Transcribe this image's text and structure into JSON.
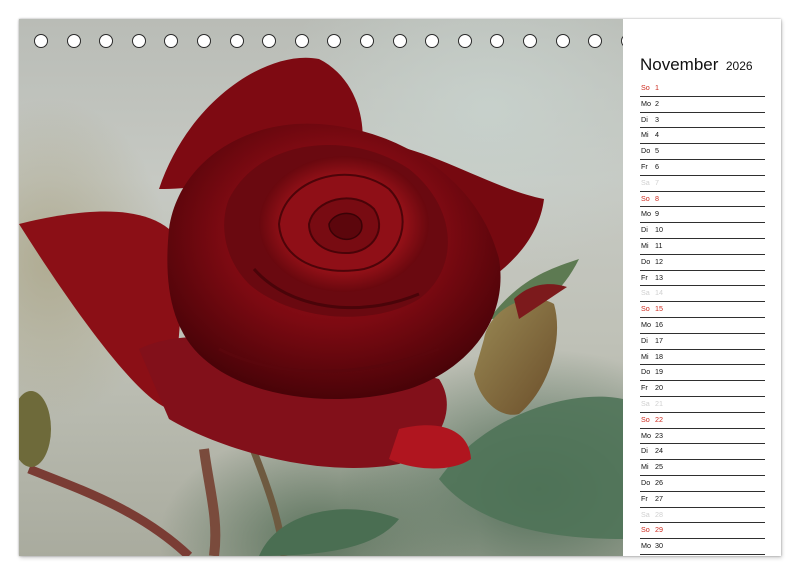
{
  "calendar": {
    "month": "November",
    "year": "2026",
    "days": [
      {
        "name": "So",
        "num": "1",
        "kind": "sunday"
      },
      {
        "name": "Mo",
        "num": "2",
        "kind": "weekday"
      },
      {
        "name": "Di",
        "num": "3",
        "kind": "weekday"
      },
      {
        "name": "Mi",
        "num": "4",
        "kind": "weekday"
      },
      {
        "name": "Do",
        "num": "5",
        "kind": "weekday"
      },
      {
        "name": "Fr",
        "num": "6",
        "kind": "weekday"
      },
      {
        "name": "Sa",
        "num": "7",
        "kind": "saturday"
      },
      {
        "name": "So",
        "num": "8",
        "kind": "sunday"
      },
      {
        "name": "Mo",
        "num": "9",
        "kind": "weekday"
      },
      {
        "name": "Di",
        "num": "10",
        "kind": "weekday"
      },
      {
        "name": "Mi",
        "num": "11",
        "kind": "weekday"
      },
      {
        "name": "Do",
        "num": "12",
        "kind": "weekday"
      },
      {
        "name": "Fr",
        "num": "13",
        "kind": "weekday"
      },
      {
        "name": "Sa",
        "num": "14",
        "kind": "saturday"
      },
      {
        "name": "So",
        "num": "15",
        "kind": "sunday"
      },
      {
        "name": "Mo",
        "num": "16",
        "kind": "weekday"
      },
      {
        "name": "Di",
        "num": "17",
        "kind": "weekday"
      },
      {
        "name": "Mi",
        "num": "18",
        "kind": "weekday"
      },
      {
        "name": "Do",
        "num": "19",
        "kind": "weekday"
      },
      {
        "name": "Fr",
        "num": "20",
        "kind": "weekday"
      },
      {
        "name": "Sa",
        "num": "21",
        "kind": "saturday"
      },
      {
        "name": "So",
        "num": "22",
        "kind": "sunday"
      },
      {
        "name": "Mo",
        "num": "23",
        "kind": "weekday"
      },
      {
        "name": "Di",
        "num": "24",
        "kind": "weekday"
      },
      {
        "name": "Mi",
        "num": "25",
        "kind": "weekday"
      },
      {
        "name": "Do",
        "num": "26",
        "kind": "weekday"
      },
      {
        "name": "Fr",
        "num": "27",
        "kind": "weekday"
      },
      {
        "name": "Sa",
        "num": "28",
        "kind": "saturday"
      },
      {
        "name": "So",
        "num": "29",
        "kind": "sunday"
      },
      {
        "name": "Mo",
        "num": "30",
        "kind": "weekday"
      }
    ]
  },
  "colors": {
    "sunday": "#cc2a1e",
    "saturday": "#d0d0d0",
    "rose": "#8e0f14",
    "leaf": "#3f6a4a"
  },
  "photo": {
    "subject": "red-rose-photo"
  }
}
